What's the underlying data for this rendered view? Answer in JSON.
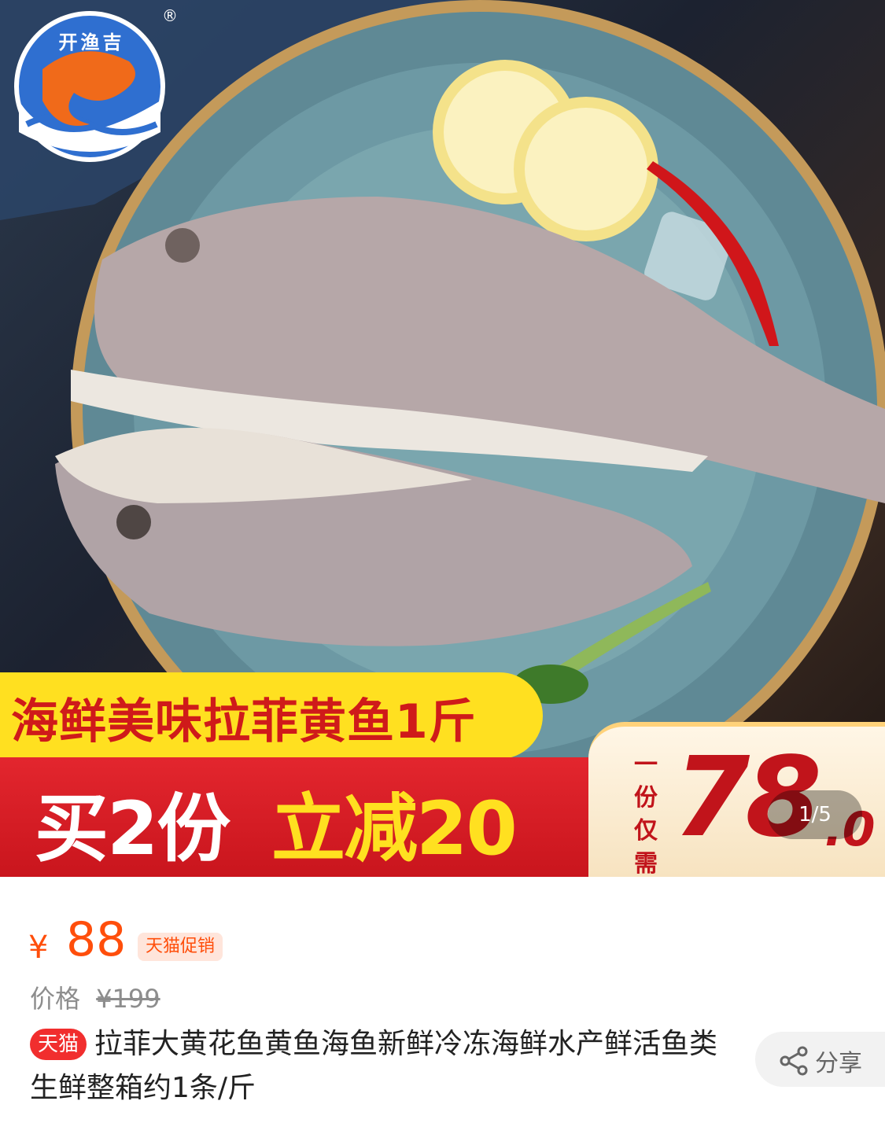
{
  "banner": {
    "brand_name": "开渔吉",
    "registered_mark": "®",
    "headline": "海鲜美味拉菲黄鱼1斤",
    "promo_prefix": "买2份",
    "promo_accent": "立减20",
    "price_label": "一份仅需",
    "price_label_chars": [
      "一",
      "份",
      "仅",
      "需"
    ],
    "price_big": "78",
    "price_decimal": ".0",
    "image_counter": "1/5"
  },
  "product": {
    "currency": "¥",
    "price": "88",
    "promo_tag": "天猫促销",
    "original_price_label": "价格",
    "original_price": "¥199",
    "platform_badge": "天猫",
    "title": "拉菲大黄花鱼黄鱼海鱼新鲜冷冻海鲜水产鲜活鱼类生鲜整箱约1条/斤"
  },
  "actions": {
    "share_label": "分享",
    "share_icon": "share-icon"
  },
  "colors": {
    "price_orange": "#ff4e0b",
    "promo_red": "#d81e26",
    "promo_yellow": "#ffe020",
    "tmall_red": "#f12e2e"
  }
}
